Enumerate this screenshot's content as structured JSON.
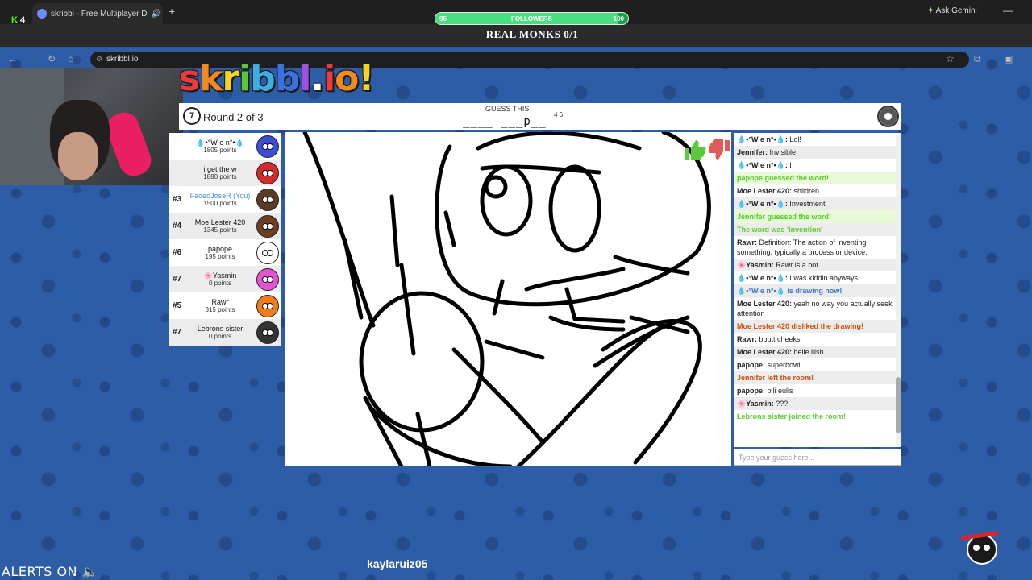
{
  "browser": {
    "tab_title": "skribbl - Free Multiplayer D",
    "url": "skribbl.io",
    "kick_count": "4",
    "gemini_label": "Ask Gemini"
  },
  "stream": {
    "followers_label": "FOLLOWERS",
    "followers_min": "95",
    "followers_max": "100",
    "followers_progress": 0.95,
    "goal_text": "REAL MONKS 0/1",
    "alerts_text": "ALERTS ON",
    "ticker_text": "kaylaruiz05"
  },
  "logo": {
    "letters": [
      "s",
      "k",
      "r",
      "i",
      "b",
      "b",
      "l",
      ".",
      "i",
      "o",
      "!"
    ]
  },
  "header": {
    "round_text": "Round 2 of 3",
    "timer": "7",
    "guess_label": "GUESS THIS",
    "word_pattern": "____ ___p__",
    "word_lengths": "4 6"
  },
  "players": [
    {
      "rank": "",
      "name": "💧•°W e n°•💧",
      "points": "1805 points",
      "color": "#3d4bd9",
      "me": false
    },
    {
      "rank": "",
      "name": "i get the w",
      "points": "1880 points",
      "color": "#d42a2a",
      "me": false
    },
    {
      "rank": "#3",
      "name": "FadedJoseR (You)",
      "points": "1500 points",
      "color": "#5b3a26",
      "me": true
    },
    {
      "rank": "#4",
      "name": "Moe Lester 420",
      "points": "1345 points",
      "color": "#6b3f22",
      "me": false
    },
    {
      "rank": "#6",
      "name": "papope",
      "points": "195 points",
      "color": "#ffffff",
      "me": false
    },
    {
      "rank": "#7",
      "name": "🌸Yasmin",
      "points": "0 points",
      "color": "#e653d1",
      "me": false
    },
    {
      "rank": "#5",
      "name": "Rawr",
      "points": "315 points",
      "color": "#f07c1a",
      "me": false
    },
    {
      "rank": "#7",
      "name": "Lebrons sister",
      "points": "0 points",
      "color": "#333333",
      "me": false
    }
  ],
  "chat": [
    {
      "type": "normal",
      "who": "💧•°W e n°•💧:",
      "text": " Lol!"
    },
    {
      "type": "normal",
      "who": "Jennifer:",
      "text": " Invisible"
    },
    {
      "type": "normal",
      "who": "💧•°W e n°•💧:",
      "text": " I"
    },
    {
      "type": "greenbg",
      "who": "",
      "text": "papope guessed the word!"
    },
    {
      "type": "normal",
      "who": "Moe Lester 420:",
      "text": " shildren"
    },
    {
      "type": "normal",
      "who": "💧•°W e n°•💧:",
      "text": " Investment"
    },
    {
      "type": "greenbg",
      "who": "",
      "text": "Jennifer guessed the word!"
    },
    {
      "type": "green",
      "who": "",
      "text": "The word was 'invention'"
    },
    {
      "type": "normal",
      "who": "Rawr:",
      "text": " Definition: The action of inventing something, typically a process or device."
    },
    {
      "type": "normal",
      "who": "🌸Yasmin:",
      "text": " Rawr is a bot"
    },
    {
      "type": "normal",
      "who": "💧•°W e n°•💧:",
      "text": " I was kiddin anyways."
    },
    {
      "type": "blue",
      "who": "",
      "text": "💧•°W e n°•💧 is drawing now!"
    },
    {
      "type": "normal",
      "who": "Moe Lester 420:",
      "text": " yeah no way you actually seek attention"
    },
    {
      "type": "orange",
      "who": "",
      "text": "Moe Lester 420 disliked the drawing!"
    },
    {
      "type": "normal",
      "who": "Rawr:",
      "text": " bbutt cheeks"
    },
    {
      "type": "normal",
      "who": "Moe Lester 420:",
      "text": " belle ilish"
    },
    {
      "type": "normal",
      "who": "papope:",
      "text": " superbowl"
    },
    {
      "type": "orange",
      "who": "",
      "text": "Jennifer left the room!"
    },
    {
      "type": "normal",
      "who": "papope:",
      "text": " bili eulis"
    },
    {
      "type": "normal",
      "who": "🌸Yasmin:",
      "text": " ???"
    },
    {
      "type": "green",
      "who": "",
      "text": "Lebrons sister joined the room!"
    }
  ],
  "input": {
    "placeholder": "Type your guess here..."
  },
  "colors": {
    "background": "#2d5da6",
    "green_msg": "#56ce27",
    "orange_msg": "#ce4f0a",
    "blue_msg": "#3975ce",
    "followers_bar": "#16a34a"
  }
}
